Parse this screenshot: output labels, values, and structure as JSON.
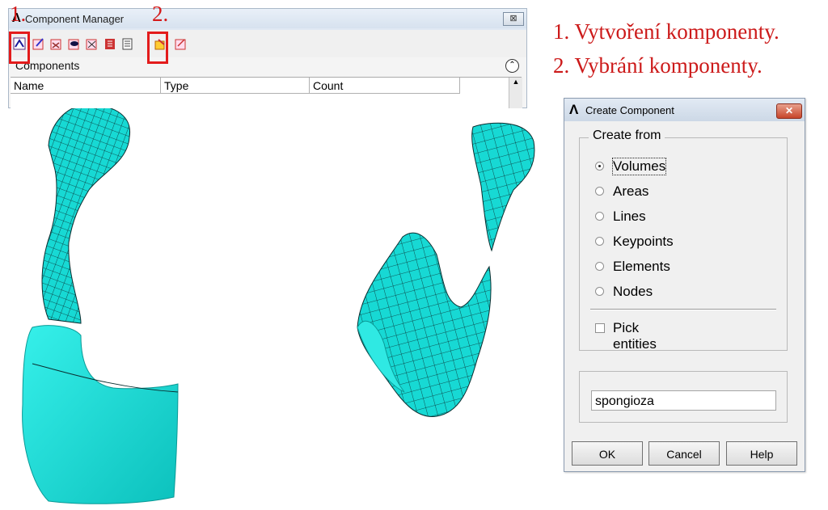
{
  "component_manager": {
    "title": "Component Manager",
    "close_glyph": "⊠",
    "section_title": "Components",
    "collapse_glyph": "⌃",
    "columns": [
      "Name",
      "Type",
      "Count"
    ],
    "toolbar_icons": [
      "create-component-icon",
      "edit-component-icon",
      "delete-component-icon",
      "view-component-icon",
      "assembly-icon",
      "list-icon",
      "select-list-icon",
      "select-component-icon",
      "reselect-component-icon"
    ]
  },
  "annotations": {
    "marker_1": "1.",
    "marker_2": "2.",
    "line_1": "1. Vytvoření komponenty.",
    "line_2": "2. Vybrání komponenty."
  },
  "create_component": {
    "title": "Create Component",
    "close_glyph": "✕",
    "group_label": "Create from",
    "options": [
      "Volumes",
      "Areas",
      "Lines",
      "Keypoints",
      "Elements",
      "Nodes"
    ],
    "selected": "Volumes",
    "pick_entities_label": "Pick entities",
    "pick_entities_checked": false,
    "name_value": "spongioza",
    "buttons": {
      "ok": "OK",
      "cancel": "Cancel",
      "help": "Help"
    }
  },
  "colors": {
    "mesh_fill": "#17d9d4",
    "mesh_line": "#0a2e30",
    "highlight_red": "#e31b1b"
  }
}
